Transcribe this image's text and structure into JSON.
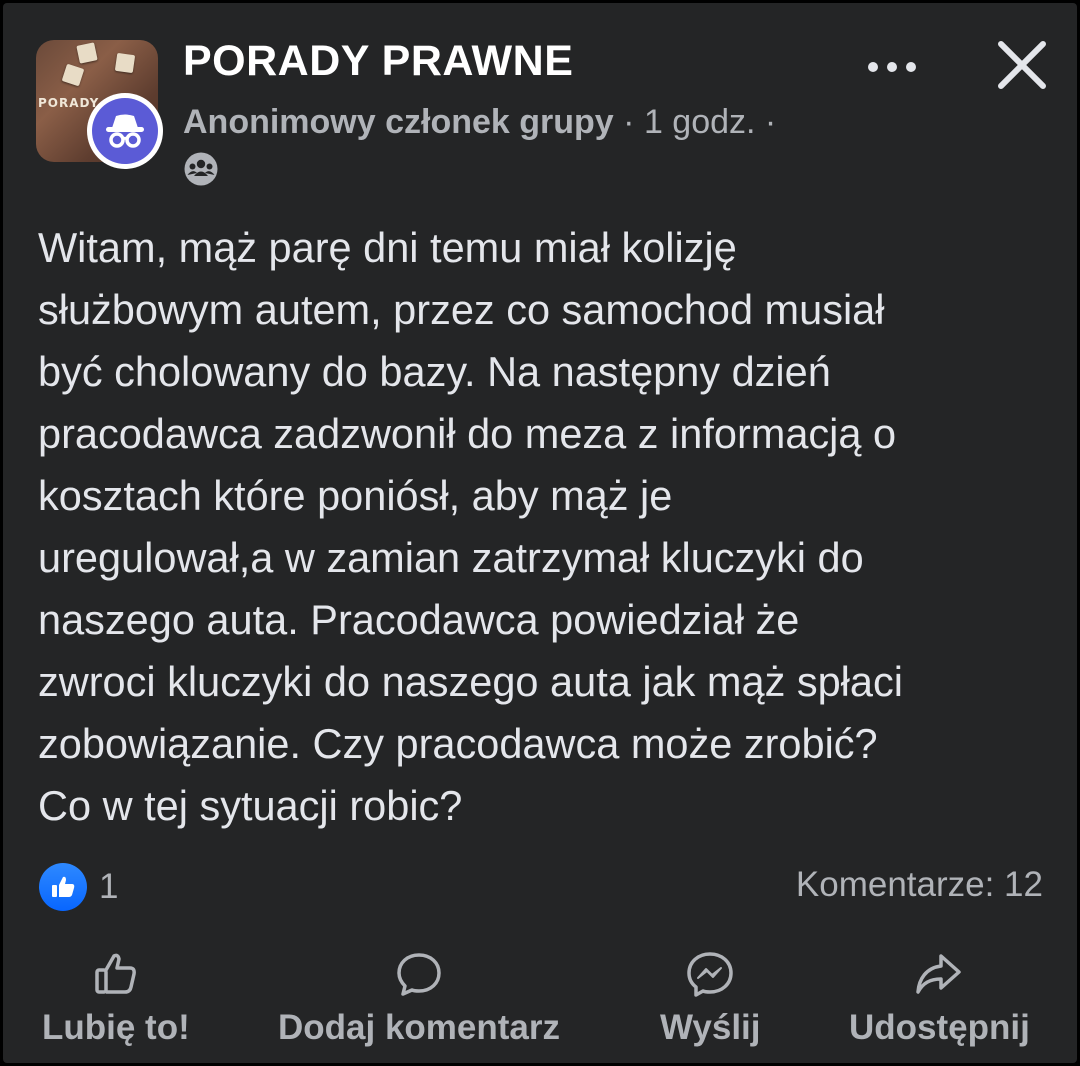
{
  "post": {
    "group_name": "PORADY PRAWNE",
    "group_avatar_word": "PORADY",
    "author": "Anonimowy członek grupy",
    "separator": " · ",
    "time": "1 godz.",
    "trailing_separator": " ·",
    "audience_icon": "group-icon",
    "member_avatar_icon": "incognito-icon",
    "body": "Witam, mąż parę dni temu miał kolizję\nsłużbowym autem, przez co samochod musiał\nbyć cholowany do bazy. Na następny dzień\npracodawca zadzwonił do meza z informacją o\nkosztach które poniósł, aby mąż je\nuregulował,a w zamian zatrzymał kluczyki do\nnaszego auta. Pracodawca powiedział że\nzwroci kluczyki do naszego auta jak mąż spłaci\nzobowiązanie. Czy pracodawca  może zrobić?\nCo w tej sytuacji robic?"
  },
  "header_controls": {
    "more_icon": "more-icon",
    "close_icon": "close-icon"
  },
  "stats": {
    "reaction_count": "1",
    "comments": "Komentarze: 12"
  },
  "actions": {
    "like": "Lubię to!",
    "comment": "Dodaj komentarz",
    "send": "Wyślij",
    "share": "Udostępnij"
  },
  "colors": {
    "background": "#242526",
    "text_primary": "#e4e6eb",
    "text_secondary": "#b0b3b8",
    "like_blue": "#0866ff",
    "incognito_purple": "#5b5bd6"
  }
}
